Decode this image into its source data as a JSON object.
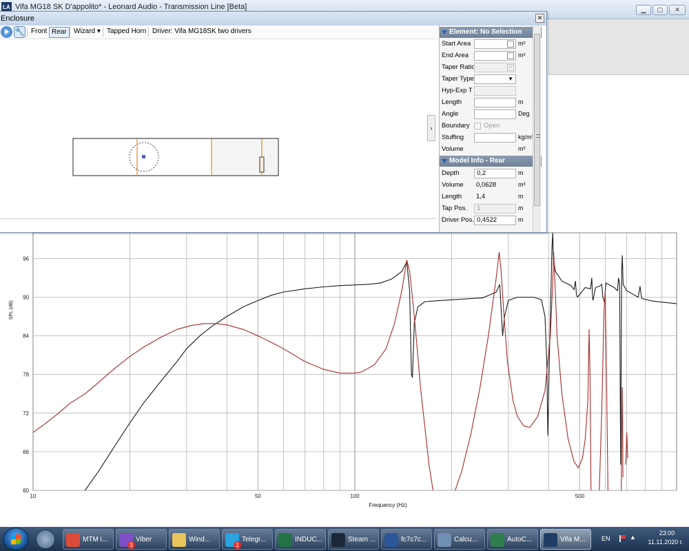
{
  "main_window": {
    "app_icon_text": "LA",
    "title": "Vifa MG18 SK D'appolito* - Leonard Audio - Transmission Line [Beta]",
    "buttons": {
      "minimize": "▁",
      "maximize": "▢",
      "close": "✕"
    }
  },
  "enclosure_window": {
    "title": "Enclosure",
    "close": "✕",
    "toolbar": {
      "front": "Front",
      "rear": "Rear",
      "wizard": "Wizard",
      "wizard_arrow": "▾",
      "tapped_horn": "Tapped Horn",
      "driver": "Driver: Vifa MG18SK two drivers"
    },
    "collapse_arrow": "›"
  },
  "properties": {
    "element_header": "Element: No Selection",
    "element_rows": [
      {
        "label": "Start Area",
        "value": "",
        "unit": "m²",
        "checkbox": true
      },
      {
        "label": "End Area",
        "value": "",
        "unit": "m²",
        "checkbox": true
      },
      {
        "label": "Taper Ratio",
        "value": "",
        "unit": "",
        "checkbox": true,
        "checked": "✓"
      },
      {
        "label": "Taper Type",
        "value": "",
        "unit": "",
        "dropdown": "▼"
      },
      {
        "label": "Hyp-Exp T",
        "value": "",
        "unit": ""
      },
      {
        "label": "Length",
        "value": "",
        "unit": "m"
      },
      {
        "label": "Angle",
        "value": "",
        "unit": "Deg"
      },
      {
        "label": "Boundary",
        "value": "Open",
        "unit": ""
      },
      {
        "label": "Stuffing",
        "value": "",
        "unit": "kg/m³"
      },
      {
        "label": "Volume",
        "value": "",
        "unit": "m³"
      }
    ],
    "model_header": "Model Info - Rear",
    "model_rows": [
      {
        "label": "Depth",
        "value": "0,2",
        "unit": "m"
      },
      {
        "label": "Volume",
        "value": "0,0628",
        "unit": "m³"
      },
      {
        "label": "Length",
        "value": "1,4",
        "unit": "m"
      },
      {
        "label": "Tap Pos.",
        "value": "1",
        "unit": "m"
      },
      {
        "label": "Driver Pos.",
        "value": "0,4522",
        "unit": "m"
      }
    ]
  },
  "chart_data": {
    "type": "line",
    "xlabel": "Frequency (Hz)",
    "ylabel": "SPL (dB)",
    "x_scale": "log",
    "xlim": [
      10,
      1000
    ],
    "ylim": [
      60,
      100
    ],
    "x_ticks": [
      10,
      50,
      100,
      500
    ],
    "y_ticks": [
      60,
      66,
      72,
      78,
      84,
      90,
      96
    ],
    "grid": true,
    "series": [
      {
        "color": "#1a1a1a",
        "points": [
          [
            14.5,
            60
          ],
          [
            16,
            63
          ],
          [
            18,
            67
          ],
          [
            20,
            70.5
          ],
          [
            22,
            73.5
          ],
          [
            25,
            77
          ],
          [
            28,
            80
          ],
          [
            30,
            82
          ],
          [
            33,
            84
          ],
          [
            36,
            85.5
          ],
          [
            40,
            87
          ],
          [
            45,
            88.5
          ],
          [
            50,
            89.5
          ],
          [
            55,
            90.3
          ],
          [
            60,
            90.8
          ],
          [
            70,
            91.3
          ],
          [
            80,
            91.6
          ],
          [
            90,
            91.8
          ],
          [
            100,
            91.9
          ],
          [
            110,
            92
          ],
          [
            120,
            92.2
          ],
          [
            130,
            92.8
          ],
          [
            140,
            94
          ],
          [
            145,
            95.5
          ],
          [
            148,
            91
          ],
          [
            150,
            78
          ],
          [
            151,
            77.5
          ],
          [
            153,
            86
          ],
          [
            157,
            88.5
          ],
          [
            165,
            89.3
          ],
          [
            200,
            89.6
          ],
          [
            250,
            89.9
          ],
          [
            275,
            90.8
          ],
          [
            282,
            92
          ],
          [
            285,
            88
          ],
          [
            288,
            84
          ],
          [
            292,
            87
          ],
          [
            300,
            89.5
          ],
          [
            320,
            90
          ],
          [
            360,
            90
          ],
          [
            380,
            89.6
          ],
          [
            390,
            87
          ],
          [
            395,
            80
          ],
          [
            398,
            68.5
          ],
          [
            402,
            80
          ],
          [
            410,
            98
          ],
          [
            412,
            100
          ],
          [
            414,
            96
          ],
          [
            420,
            94
          ],
          [
            440,
            92.5
          ],
          [
            470,
            91.8
          ],
          [
            480,
            91.2
          ],
          [
            485,
            92.5
          ],
          [
            488,
            90.5
          ],
          [
            492,
            90
          ],
          [
            520,
            91.5
          ],
          [
            540,
            91.3
          ],
          [
            545,
            93
          ],
          [
            548,
            90
          ],
          [
            550,
            89.5
          ],
          [
            560,
            91.5
          ],
          [
            580,
            91.8
          ],
          [
            585,
            92
          ],
          [
            590,
            90
          ],
          [
            597,
            89.2
          ],
          [
            603,
            92.2
          ],
          [
            640,
            91.5
          ],
          [
            655,
            91
          ],
          [
            660,
            93
          ],
          [
            665,
            92
          ],
          [
            670,
            64
          ],
          [
            675,
            94
          ],
          [
            678,
            96.5
          ],
          [
            682,
            92
          ],
          [
            700,
            91
          ],
          [
            760,
            90
          ],
          [
            770,
            91.7
          ],
          [
            775,
            90.5
          ],
          [
            780,
            89.8
          ],
          [
            840,
            89.4
          ],
          [
            1000,
            89
          ]
        ]
      },
      {
        "color": "#a52a2a",
        "points": [
          [
            10,
            69
          ],
          [
            11,
            70.5
          ],
          [
            12,
            72
          ],
          [
            13,
            73.5
          ],
          [
            14.5,
            75
          ],
          [
            16,
            76.8
          ],
          [
            18,
            79
          ],
          [
            20,
            80.8
          ],
          [
            22,
            82.2
          ],
          [
            25,
            83.8
          ],
          [
            28,
            85
          ],
          [
            31,
            85.6
          ],
          [
            34,
            85.9
          ],
          [
            37,
            85.9
          ],
          [
            40,
            85.7
          ],
          [
            45,
            85
          ],
          [
            50,
            84
          ],
          [
            55,
            83
          ],
          [
            60,
            82
          ],
          [
            70,
            80
          ],
          [
            80,
            78.8
          ],
          [
            90,
            78.2
          ],
          [
            100,
            78.2
          ],
          [
            105,
            78.4
          ],
          [
            115,
            79.5
          ],
          [
            125,
            82
          ],
          [
            133,
            86
          ],
          [
            140,
            91
          ],
          [
            145,
            95.8
          ],
          [
            148,
            94
          ],
          [
            151,
            90
          ],
          [
            155,
            84
          ],
          [
            160,
            76
          ],
          [
            170,
            64
          ],
          [
            175,
            60
          ]
        ]
      },
      {
        "color": "#a52a2a",
        "points": [
          [
            205,
            60
          ],
          [
            215,
            63
          ],
          [
            230,
            69
          ],
          [
            245,
            76
          ],
          [
            260,
            84
          ],
          [
            270,
            90
          ],
          [
            275,
            93
          ],
          [
            281,
            97
          ],
          [
            285,
            94
          ],
          [
            290,
            88
          ],
          [
            298,
            80
          ],
          [
            310,
            74
          ],
          [
            320,
            71.5
          ],
          [
            335,
            70
          ],
          [
            350,
            69.8
          ],
          [
            370,
            71.5
          ],
          [
            390,
            75.5
          ],
          [
            405,
            84
          ],
          [
            412,
            92
          ],
          [
            415,
            97
          ],
          [
            419,
            92
          ],
          [
            425,
            84
          ],
          [
            440,
            75
          ],
          [
            460,
            68
          ],
          [
            480,
            64.5
          ],
          [
            495,
            63.5
          ],
          [
            510,
            65
          ],
          [
            520,
            68
          ],
          [
            530,
            74
          ],
          [
            535,
            85
          ],
          [
            538,
            78
          ],
          [
            542,
            60
          ]
        ]
      },
      {
        "color": "#a52a2a",
        "points": [
          [
            575,
            60
          ],
          [
            585,
            72
          ],
          [
            595,
            88
          ],
          [
            600,
            91
          ],
          [
            604,
            82
          ],
          [
            612,
            60
          ]
        ]
      },
      {
        "color": "#a52a2a",
        "points": [
          [
            673,
            60
          ],
          [
            675,
            68
          ],
          [
            678,
            76
          ],
          [
            681,
            62
          ]
        ]
      },
      {
        "color": "#a52a2a",
        "points": [
          [
            695,
            64
          ],
          [
            700,
            69
          ],
          [
            705,
            65
          ]
        ]
      }
    ]
  },
  "taskbar": {
    "items": [
      {
        "label": "MTM i...",
        "icon_color": "#dd4b39"
      },
      {
        "label": "Viber",
        "icon_color": "#7d50c7",
        "badge": "3"
      },
      {
        "label": "Wind...",
        "icon_color": "#e8c55a"
      },
      {
        "label": "Telegr...",
        "icon_color": "#2aa3df",
        "badge": "1"
      },
      {
        "label": "INDUC...",
        "icon_color": "#217346"
      },
      {
        "label": "Steam ...",
        "icon_color": "#1b2838"
      },
      {
        "label": "fc7c7c...",
        "icon_color": "#2b579a"
      },
      {
        "label": "Calcu...",
        "icon_color": "#6f8fb3"
      },
      {
        "label": "AutoC...",
        "icon_color": "#2f7f4e"
      },
      {
        "label": "Vifa M...",
        "icon_color": "#1f3d66",
        "active": true
      }
    ],
    "lang": "EN",
    "tray_arrow": "▲",
    "time": "23:00",
    "date": "11.11.2020 г."
  }
}
